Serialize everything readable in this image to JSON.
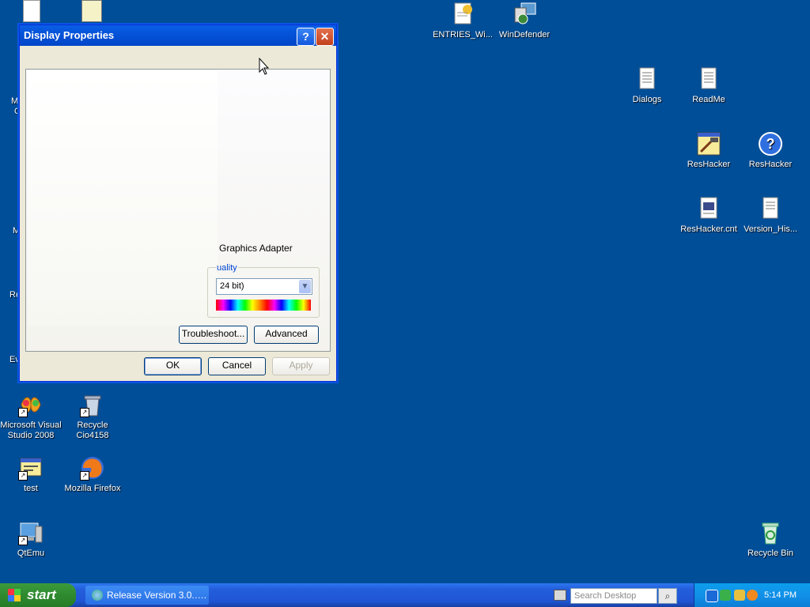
{
  "desktop": {
    "icons": [
      {
        "label": "ENTRIES_Wi...",
        "icon": "notepad-doc-icon"
      },
      {
        "label": "WinDefender",
        "icon": "windefender-icon"
      },
      {
        "label": "Dialogs",
        "icon": "text-document-icon"
      },
      {
        "label": "ReadMe",
        "icon": "text-document-icon"
      },
      {
        "label": "ResHacker",
        "icon": "reshacker-app-icon"
      },
      {
        "label": "ResHacker",
        "icon": "help-file-icon"
      },
      {
        "label": "ResHacker.cnt",
        "icon": "cnt-file-icon"
      },
      {
        "label": "Version_His...",
        "icon": "text-document-icon"
      },
      {
        "label": "Microsoft Visual Studio 2008",
        "icon": "visual-studio-icon"
      },
      {
        "label": "Recycle Cio4158",
        "icon": "recycle-bin-icon"
      },
      {
        "label": "test",
        "icon": "exe-file-icon"
      },
      {
        "label": "Mozilla Firefox",
        "icon": "firefox-icon"
      },
      {
        "label": "QtEmu",
        "icon": "qtemu-icon"
      },
      {
        "label": "Recycle Bin",
        "icon": "recycle-bin-icon"
      }
    ],
    "edge_text": [
      "M",
      "C",
      "M",
      "Re",
      "Ev"
    ]
  },
  "dialog": {
    "title": "Display Properties",
    "help_glyph": "?",
    "close_glyph": "✕",
    "device_label": "Graphics Adapter",
    "color_quality_legend": "uality",
    "color_quality_value": "24 bit)",
    "troubleshoot_label": "Troubleshoot...",
    "advanced_label": "Advanced",
    "ok_label": "OK",
    "cancel_label": "Cancel",
    "apply_label": "Apply"
  },
  "taskbar": {
    "start_label": "start",
    "task_button_label": "Release Version 3.0.….",
    "search_placeholder": "Search Desktop",
    "clock": "5:14 PM"
  },
  "colors": {
    "desktop_bg": "#004e98",
    "titlebar": "#0553d9",
    "start_green": "#2f8a2f"
  }
}
